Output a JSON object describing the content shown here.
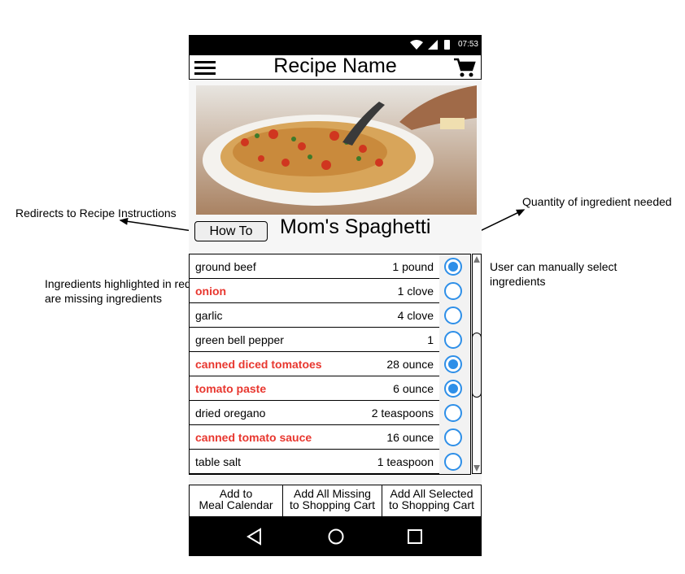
{
  "annotations": {
    "redirect": "Redirects to Recipe Instructions",
    "quantity": "Quantity of ingredient needed",
    "missing": "Ingredients highlighted in red are missing ingredients",
    "select": "User can manually select ingredients"
  },
  "status_bar": {
    "time": "07:53",
    "icons": [
      "wifi-icon",
      "signal-icon",
      "battery-icon"
    ]
  },
  "app_bar": {
    "title": "Recipe Name",
    "menu_icon": "hamburger-icon",
    "cart_icon": "cart-icon"
  },
  "recipe": {
    "image": "spaghetti-photo",
    "how_to_label": "How To",
    "title": "Mom's Spaghetti"
  },
  "ingredients": [
    {
      "name": "ground beef",
      "quantity": "1 pound",
      "missing": false,
      "selected": true
    },
    {
      "name": "onion",
      "quantity": "1 clove",
      "missing": true,
      "selected": false
    },
    {
      "name": "garlic",
      "quantity": "4 clove",
      "missing": false,
      "selected": false
    },
    {
      "name": "green bell pepper",
      "quantity": "1",
      "missing": false,
      "selected": false
    },
    {
      "name": "canned diced tomatoes",
      "quantity": "28 ounce",
      "missing": true,
      "selected": true
    },
    {
      "name": "tomato paste",
      "quantity": "6 ounce",
      "missing": true,
      "selected": true
    },
    {
      "name": "dried oregano",
      "quantity": "2 teaspoons",
      "missing": false,
      "selected": false
    },
    {
      "name": "canned tomato sauce",
      "quantity": "16 ounce",
      "missing": true,
      "selected": false
    },
    {
      "name": "table salt",
      "quantity": "1 teaspoon",
      "missing": false,
      "selected": false
    }
  ],
  "actions": {
    "add_to_calendar": "Add to\nMeal Calendar",
    "add_missing": "Add All Missing\nto Shopping Cart",
    "add_selected": "Add All Selected\nto Shopping Cart"
  },
  "nav_bar": {
    "icons": [
      "back-icon",
      "home-icon",
      "recent-apps-icon"
    ]
  },
  "colors": {
    "missing": "#e8372f",
    "radio": "#2e8fe8",
    "bars": "#000000"
  }
}
